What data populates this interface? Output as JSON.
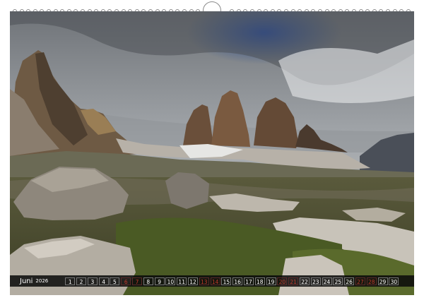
{
  "calendar": {
    "month": "Juni",
    "year": "2026",
    "days": [
      {
        "n": "1",
        "weekend": false
      },
      {
        "n": "2",
        "weekend": false
      },
      {
        "n": "3",
        "weekend": false
      },
      {
        "n": "4",
        "weekend": false
      },
      {
        "n": "5",
        "weekend": false
      },
      {
        "n": "6",
        "weekend": true
      },
      {
        "n": "7",
        "weekend": true
      },
      {
        "n": "8",
        "weekend": false
      },
      {
        "n": "9",
        "weekend": false
      },
      {
        "n": "10",
        "weekend": false
      },
      {
        "n": "11",
        "weekend": false
      },
      {
        "n": "12",
        "weekend": false
      },
      {
        "n": "13",
        "weekend": true
      },
      {
        "n": "14",
        "weekend": true
      },
      {
        "n": "15",
        "weekend": false
      },
      {
        "n": "16",
        "weekend": false
      },
      {
        "n": "17",
        "weekend": false
      },
      {
        "n": "18",
        "weekend": false
      },
      {
        "n": "19",
        "weekend": false
      },
      {
        "n": "20",
        "weekend": true
      },
      {
        "n": "21",
        "weekend": true
      },
      {
        "n": "22",
        "weekend": false
      },
      {
        "n": "23",
        "weekend": false
      },
      {
        "n": "24",
        "weekend": false
      },
      {
        "n": "25",
        "weekend": false
      },
      {
        "n": "26",
        "weekend": false
      },
      {
        "n": "27",
        "weekend": true
      },
      {
        "n": "28",
        "weekend": true
      },
      {
        "n": "29",
        "weekend": false
      },
      {
        "n": "30",
        "weekend": false
      }
    ]
  },
  "colors": {
    "weekday_text": "#ffffff",
    "weekend_text": "#c0392b",
    "bar_background": "#0a0a0a"
  }
}
